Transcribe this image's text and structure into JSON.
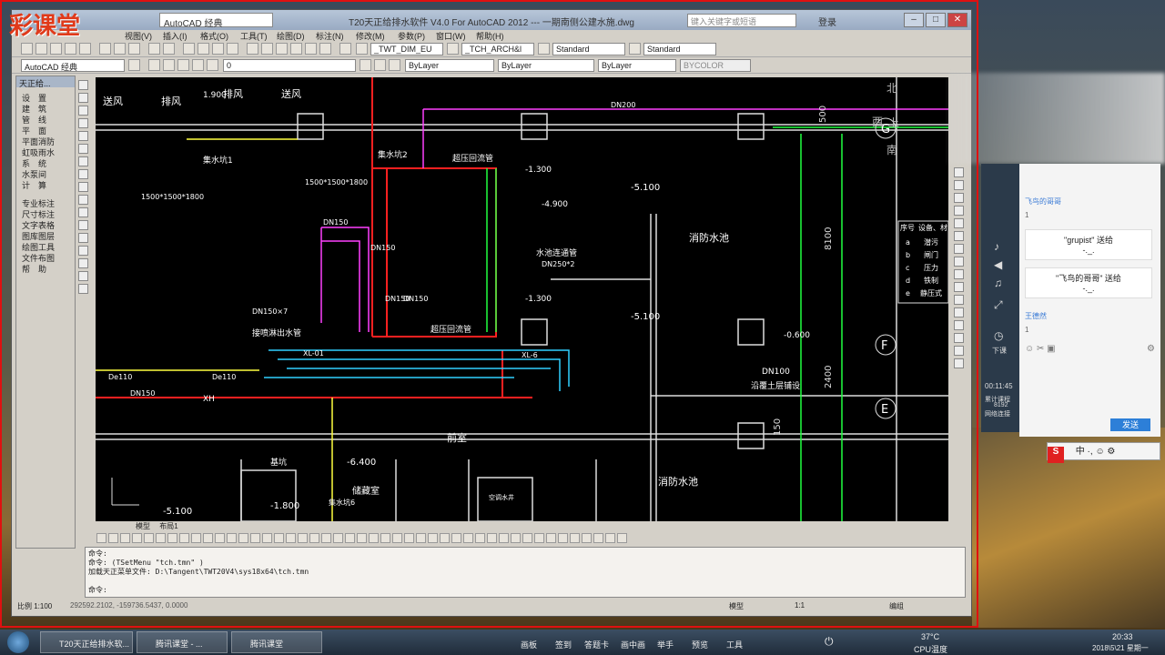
{
  "watermark": "彩课堂",
  "window": {
    "title": "T20天正给排水软件 V4.0 For AutoCAD 2012 --- 一期南侧公建水施.dwg",
    "workspace": "AutoCAD 经典",
    "search_placeholder": "键入关键字或短语",
    "login": "登录"
  },
  "menu": [
    "视图(V)",
    "插入(I)",
    "格式(O)",
    "工具(T)",
    "绘图(D)",
    "标注(N)",
    "修改(M)",
    "参数(P)",
    "窗口(W)",
    "帮助(H)"
  ],
  "toolbar": {
    "text_style": "_TWT_DIM_EU",
    "text_style2": "_TCH_ARCH&l",
    "dim_style": "Standard",
    "table_style": "Standard",
    "workspace2": "AutoCAD 经典",
    "layer": "0",
    "color": "ByLayer",
    "linetype": "ByLayer",
    "lineweight": "ByLayer",
    "plotstyle": "BYCOLOR"
  },
  "palette": {
    "title": "天正给...",
    "items": [
      "设　置",
      "建　筑",
      "管　线",
      "平　面",
      "平面消防",
      "虹吸雨水",
      "系　统",
      "水泵间",
      "计　算",
      "专业标注",
      "尺寸标注",
      "文字表格",
      "图库图层",
      "绘图工具",
      "文件布图",
      "帮　助"
    ]
  },
  "drawing": {
    "labels": [
      "送风",
      "排风",
      "排风",
      "送风",
      "1.900",
      "集水坑1",
      "集水坑2",
      "1500*1500*1800",
      "1500*1500*1800",
      "超压回流管",
      "-1.300",
      "-4.900",
      "-5.100",
      "消防水池",
      "DN150",
      "DN150",
      "DN200",
      "水池连通管",
      "DN250*2",
      "-1.300",
      "-5.100",
      "DN150×7",
      "接喷淋出水管",
      "XL-01",
      "超压回流管",
      "XL-6",
      "DN100",
      "沿覆土层铺设",
      "-0.600",
      "De110",
      "De110",
      "DN150",
      "XH",
      "前室",
      "基坑",
      "-6.400",
      "储藏室",
      "集水坑6",
      "-1.800",
      "-5.100",
      "消防水池",
      "空调水井",
      "DN150",
      "DN150"
    ],
    "axis_markers": [
      "F",
      "E",
      "G"
    ],
    "dims": [
      "500",
      "8100",
      "2400",
      "150"
    ],
    "table_headers": [
      "序号",
      "设备、材"
    ],
    "table_rows": [
      [
        "a",
        "潜污"
      ],
      [
        "b",
        "闸门"
      ],
      [
        "c",
        "压力"
      ],
      [
        "d",
        "铁制"
      ],
      [
        "e",
        "静压式"
      ]
    ],
    "compass": {
      "n": "北",
      "s": "南",
      "w": "西",
      "top": "上"
    }
  },
  "layout_tabs": [
    "模型",
    "布局1"
  ],
  "command": {
    "lines": [
      "命令:",
      "命令: (TSetMenu \"tch.tmn\" )",
      "加载天正菜单文件: D:\\Tangent\\TWT20V4\\sys18x64\\tch.tmn",
      "",
      "命令:"
    ]
  },
  "status": {
    "scale": "比例 1:100",
    "coords": "292592.2102, -159736.5437, 0.0000",
    "model": "模型",
    "ann_scale": "1:1",
    "edit": "编组"
  },
  "chat": {
    "gifts": [
      {
        "text": "\"grupist\" 送给",
        "sub": "-._."
      },
      {
        "text": "\"飞鸟的哥哥\" 送给",
        "sub": "-._."
      }
    ],
    "users": [
      "飞鸟的哥哥",
      "王德然"
    ],
    "nums": [
      "1",
      "1"
    ],
    "send": "发送",
    "timer": "00:11:45",
    "total_label": "累计课程",
    "total": "8192",
    "net": "网络连接",
    "down": "下课"
  },
  "taskbar": {
    "tasks": [
      "T20天正给排水软...",
      "腾讯课堂 - ...",
      "腾讯课堂"
    ],
    "tools": [
      "画板",
      "签到",
      "答题卡",
      "画中画",
      "举手",
      "预览",
      "工具"
    ],
    "cpu": "37°C",
    "cpu_label": "CPU温度",
    "time": "20:33",
    "date": "2018\\5\\21 星期一"
  }
}
